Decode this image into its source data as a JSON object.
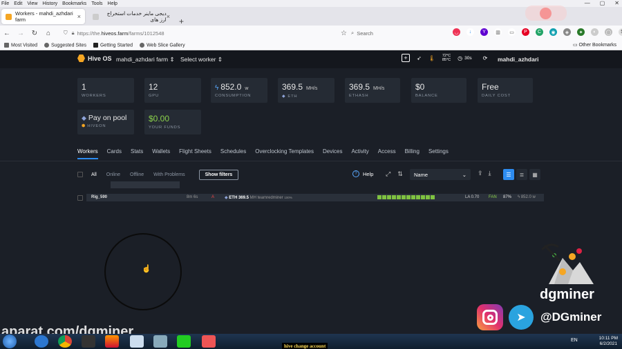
{
  "browser": {
    "menu": [
      "File",
      "Edit",
      "View",
      "History",
      "Bookmarks",
      "Tools",
      "Help"
    ],
    "tabs": [
      {
        "title": "Workers - mahdi_azhdari farm"
      },
      {
        "title": "دیجی ماینر خدمات استخراج ارز های"
      }
    ],
    "url_prefix": "https://the.",
    "url_host": "hiveos.farm",
    "url_path": "/farms/1012548",
    "search_placeholder": "Search",
    "bookmarks": [
      "Most Visited",
      "Suggested Sites",
      "Getting Started",
      "Web Slice Gallery"
    ],
    "other_bookmarks": "Other Bookmarks"
  },
  "app": {
    "brand": "Hive OS",
    "farm": "mahdi_azhdari farm",
    "select_worker": "Select worker",
    "temp_top": "72°C",
    "temp_bottom": "85°C",
    "timer": "30s",
    "user": "mahdi_azhdari"
  },
  "stats": [
    {
      "value": "1",
      "unit": "",
      "label": "WORKERS"
    },
    {
      "value": "12",
      "unit": "",
      "label": "GPU"
    },
    {
      "value": "852.0",
      "unit": "w",
      "label": "CONSUMPTION"
    },
    {
      "value": "369.5",
      "unit": "MH/s",
      "label": "ETH"
    },
    {
      "value": "369.5",
      "unit": "MH/s",
      "label": "ETHASH"
    },
    {
      "value": "$0",
      "unit": "",
      "label": "BALANCE"
    },
    {
      "value": "Free",
      "unit": "",
      "label": "DAILY COST"
    }
  ],
  "stats2": [
    {
      "value": "Pay on pool",
      "label": "HIVEON"
    },
    {
      "value": "$0.00",
      "label": "YOUR FUNDS"
    }
  ],
  "nav_tabs": [
    "Workers",
    "Cards",
    "Stats",
    "Wallets",
    "Flight Sheets",
    "Schedules",
    "Overclocking Templates",
    "Devices",
    "Activity",
    "Access",
    "Billing",
    "Settings"
  ],
  "filters": {
    "items": [
      "All",
      "Online",
      "Offline",
      "With Problems"
    ],
    "show_filters": "Show filters",
    "help": "Help",
    "sort_by": "Name"
  },
  "worker_row": {
    "name": "Rig_590",
    "uptime": "8m 6s",
    "alert": "A",
    "coin": "ETH",
    "hashrate": "369.5",
    "miner": "MH teamredminer",
    "share": "100%",
    "gpu_count": 12,
    "la": "LA 0.70",
    "fan": "FAN",
    "fan_pct": "87%",
    "power": "852.0 w"
  },
  "overlay": {
    "brand": "dgminer",
    "handle": "@DGminer",
    "site": "aparat.com/dgminer"
  },
  "taskbar": {
    "caption": "hive change account",
    "lang": "EN",
    "time": "10:11 PM",
    "date": "6/2/2021"
  },
  "colors": {
    "accent": "#2d8cf0",
    "hive_orange": "#f5a623",
    "ok_green": "#7fc241",
    "bg": "#1b1f27",
    "card": "#252b34"
  }
}
